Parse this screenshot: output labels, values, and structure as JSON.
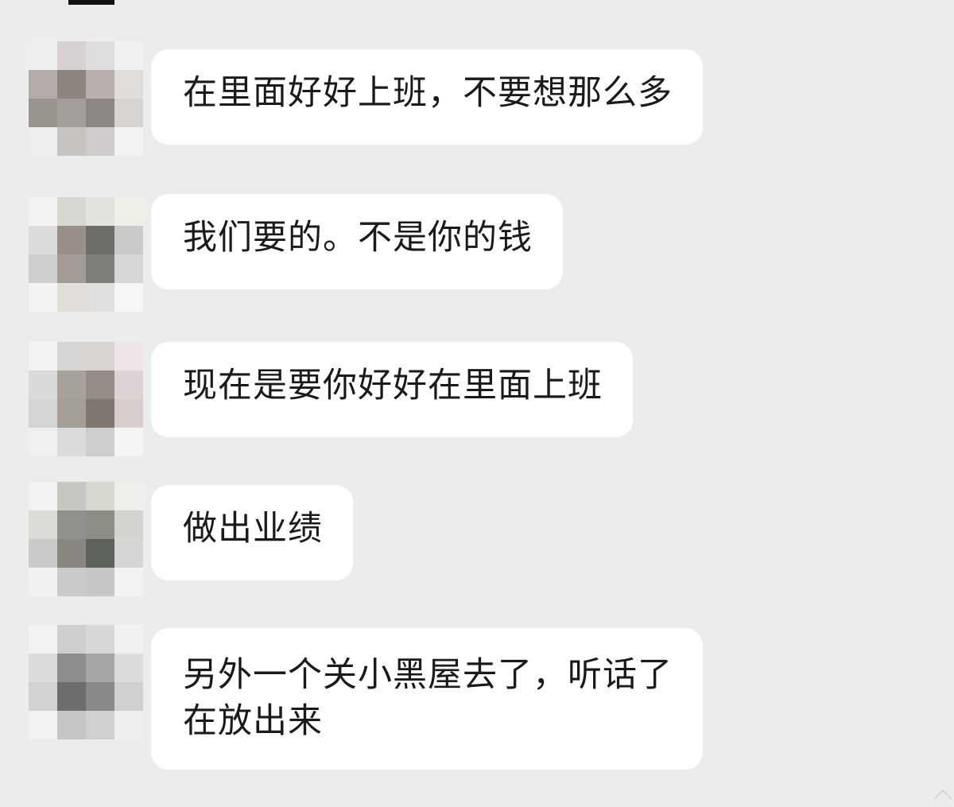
{
  "messages": [
    {
      "text": "在里面好好上班，不要想那么多",
      "avatar_pixels": [
        "#eeeeee",
        "#d7d2d1",
        "#dddddd",
        "#f1f1f1",
        "#b4aca8",
        "#8d8580",
        "#b6afab",
        "#e0dddb",
        "#9a948f",
        "#a59f9b",
        "#8c8783",
        "#d6d3d1",
        "#efefef",
        "#c7c4c2",
        "#cfcccb",
        "#f3f3f3"
      ]
    },
    {
      "text": "我们要的。不是你的钱",
      "avatar_pixels": [
        "#f2f2f2",
        "#d8d7d1",
        "#e3e2de",
        "#eef0e6",
        "#dcdcdc",
        "#989089",
        "#6e6c69",
        "#cacac8",
        "#cfcfcf",
        "#a39b95",
        "#7f7e7b",
        "#d7d7d7",
        "#f3f3f3",
        "#e1ddd8",
        "#dde0dc",
        "#f6f6f6"
      ]
    },
    {
      "text": "现在是要你好好在里面上班",
      "avatar_pixels": [
        "#f3f3f3",
        "#d7d5d3",
        "#d8d5d2",
        "#efe6e8",
        "#dadada",
        "#a8a29d",
        "#968d86",
        "#dcd3d4",
        "#d5d5d5",
        "#a59f9a",
        "#7e7770",
        "#d6cfcb",
        "#f0f0f0",
        "#dcdcdc",
        "#cecece",
        "#f4f4f4"
      ]
    },
    {
      "text": "做出业绩",
      "avatar_pixels": [
        "#f2f2f2",
        "#c8c8c2",
        "#d8d7d0",
        "#efefea",
        "#dcdcd8",
        "#90918a",
        "#8c8d85",
        "#d3d4cd",
        "#cbcbcb",
        "#8a8780",
        "#5e625c",
        "#d6d6d4",
        "#f1f1f1",
        "#cbcbcb",
        "#c7c7c7",
        "#f2f2f2"
      ]
    },
    {
      "text": "另外一个关小黑屋去了，听话了\n在放出来",
      "avatar_pixels": [
        "#f3f3f3",
        "#cfcfcf",
        "#d8d8d8",
        "#f1f1f1",
        "#dcdcdc",
        "#8f8d8b",
        "#a7a6a4",
        "#dcdcdc",
        "#d2d2d2",
        "#6f6d6b",
        "#8b8987",
        "#d0d0d0",
        "#f2f2f2",
        "#c6c6c6",
        "#d0d0d0",
        "#f0eeee"
      ]
    }
  ]
}
